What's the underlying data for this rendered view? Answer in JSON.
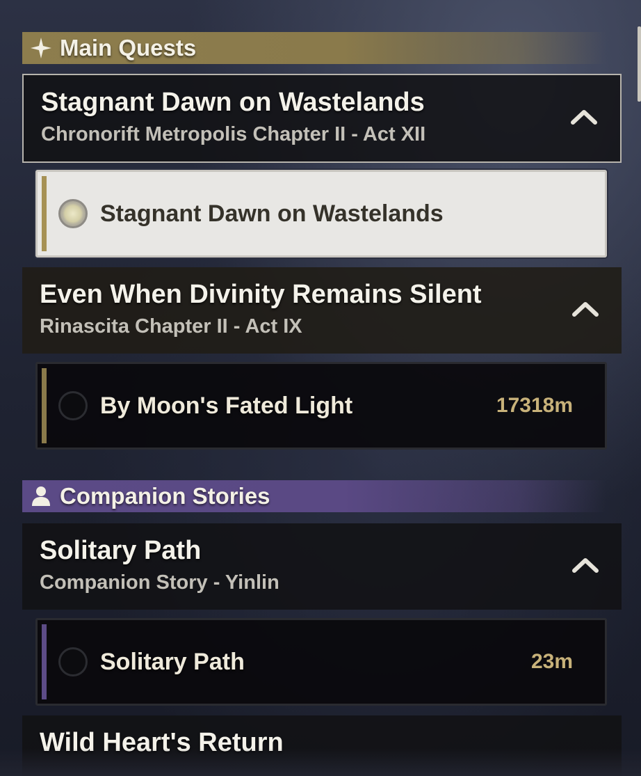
{
  "sections": [
    {
      "title": "Main Quests",
      "icon": "sparkle-icon",
      "color": "#8d7d4d",
      "quests": [
        {
          "title": "Stagnant Dawn on Wastelands",
          "subtitle": "Chronorift Metropolis Chapter II - Act XII",
          "expanded": true,
          "objectives": [
            {
              "title": "Stagnant Dawn on Wastelands",
              "distance": "",
              "selected": true
            }
          ]
        },
        {
          "title": "Even When Divinity Remains Silent",
          "subtitle": "Rinascita Chapter II - Act IX",
          "expanded": true,
          "objectives": [
            {
              "title": "By Moon's Fated Light",
              "distance": "17318m",
              "selected": false
            }
          ]
        }
      ]
    },
    {
      "title": "Companion Stories",
      "icon": "person-icon",
      "color": "#5b4a86",
      "quests": [
        {
          "title": "Solitary Path",
          "subtitle": "Companion Story - Yinlin",
          "expanded": true,
          "objectives": [
            {
              "title": "Solitary Path",
              "distance": "23m",
              "selected": false
            }
          ]
        },
        {
          "title": "Wild Heart's Return",
          "subtitle": "",
          "expanded": false,
          "objectives": []
        }
      ]
    }
  ],
  "colors": {
    "gold_accent": "#a08c55",
    "purple_accent": "#6a5596",
    "distance_text": "#c8b27a"
  }
}
